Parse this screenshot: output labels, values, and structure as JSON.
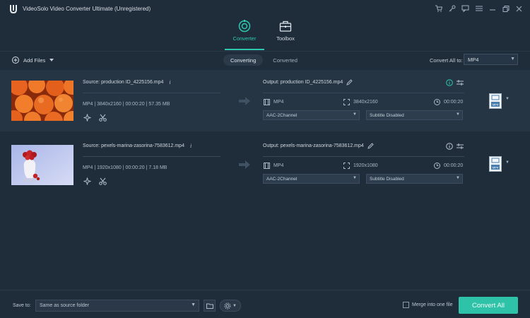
{
  "app": {
    "title": "VideoSolo Video Converter Ultimate (Unregistered)"
  },
  "nav": {
    "tabs": [
      {
        "label": "Converter",
        "active": true
      },
      {
        "label": "Toolbox",
        "active": false
      }
    ]
  },
  "toolbar": {
    "add_files": "Add Files",
    "subtabs": [
      {
        "label": "Converting",
        "active": true
      },
      {
        "label": "Converted",
        "active": false
      }
    ],
    "convert_all_label": "Convert All to:",
    "convert_all_value": "MP4"
  },
  "files": [
    {
      "source": "Source: production ID_4225156.mp4",
      "meta": "MP4  |  3840x2160  |  00:00:20  |  57.35 MB",
      "output": "Output: production ID_4225156.mp4",
      "out_format": "MP4",
      "out_resolution": "3840x2160",
      "out_duration": "00:00:20",
      "audio": "AAC-2Channel",
      "subtitle": "Subtitle Disabled",
      "format_badge": "MP4"
    },
    {
      "source": "Source: pexels-marina-zasorina-7583612.mp4",
      "meta": "MP4  |  1920x1080  |  00:00:20  |  7.18 MB",
      "output": "Output: pexels-marina-zasorina-7583612.mp4",
      "out_format": "MP4",
      "out_resolution": "1920x1080",
      "out_duration": "00:00:20",
      "audio": "AAC-2Channel",
      "subtitle": "Subtitle Disabled",
      "format_badge": "MP4"
    }
  ],
  "bottom": {
    "save_to_label": "Save to:",
    "save_to_value": "Same as source folder",
    "merge_label": "Merge into one file",
    "convert_button": "Convert All"
  },
  "colors": {
    "accent": "#2cc9b0",
    "background": "#1f2c39",
    "row_highlight": "#263544"
  }
}
